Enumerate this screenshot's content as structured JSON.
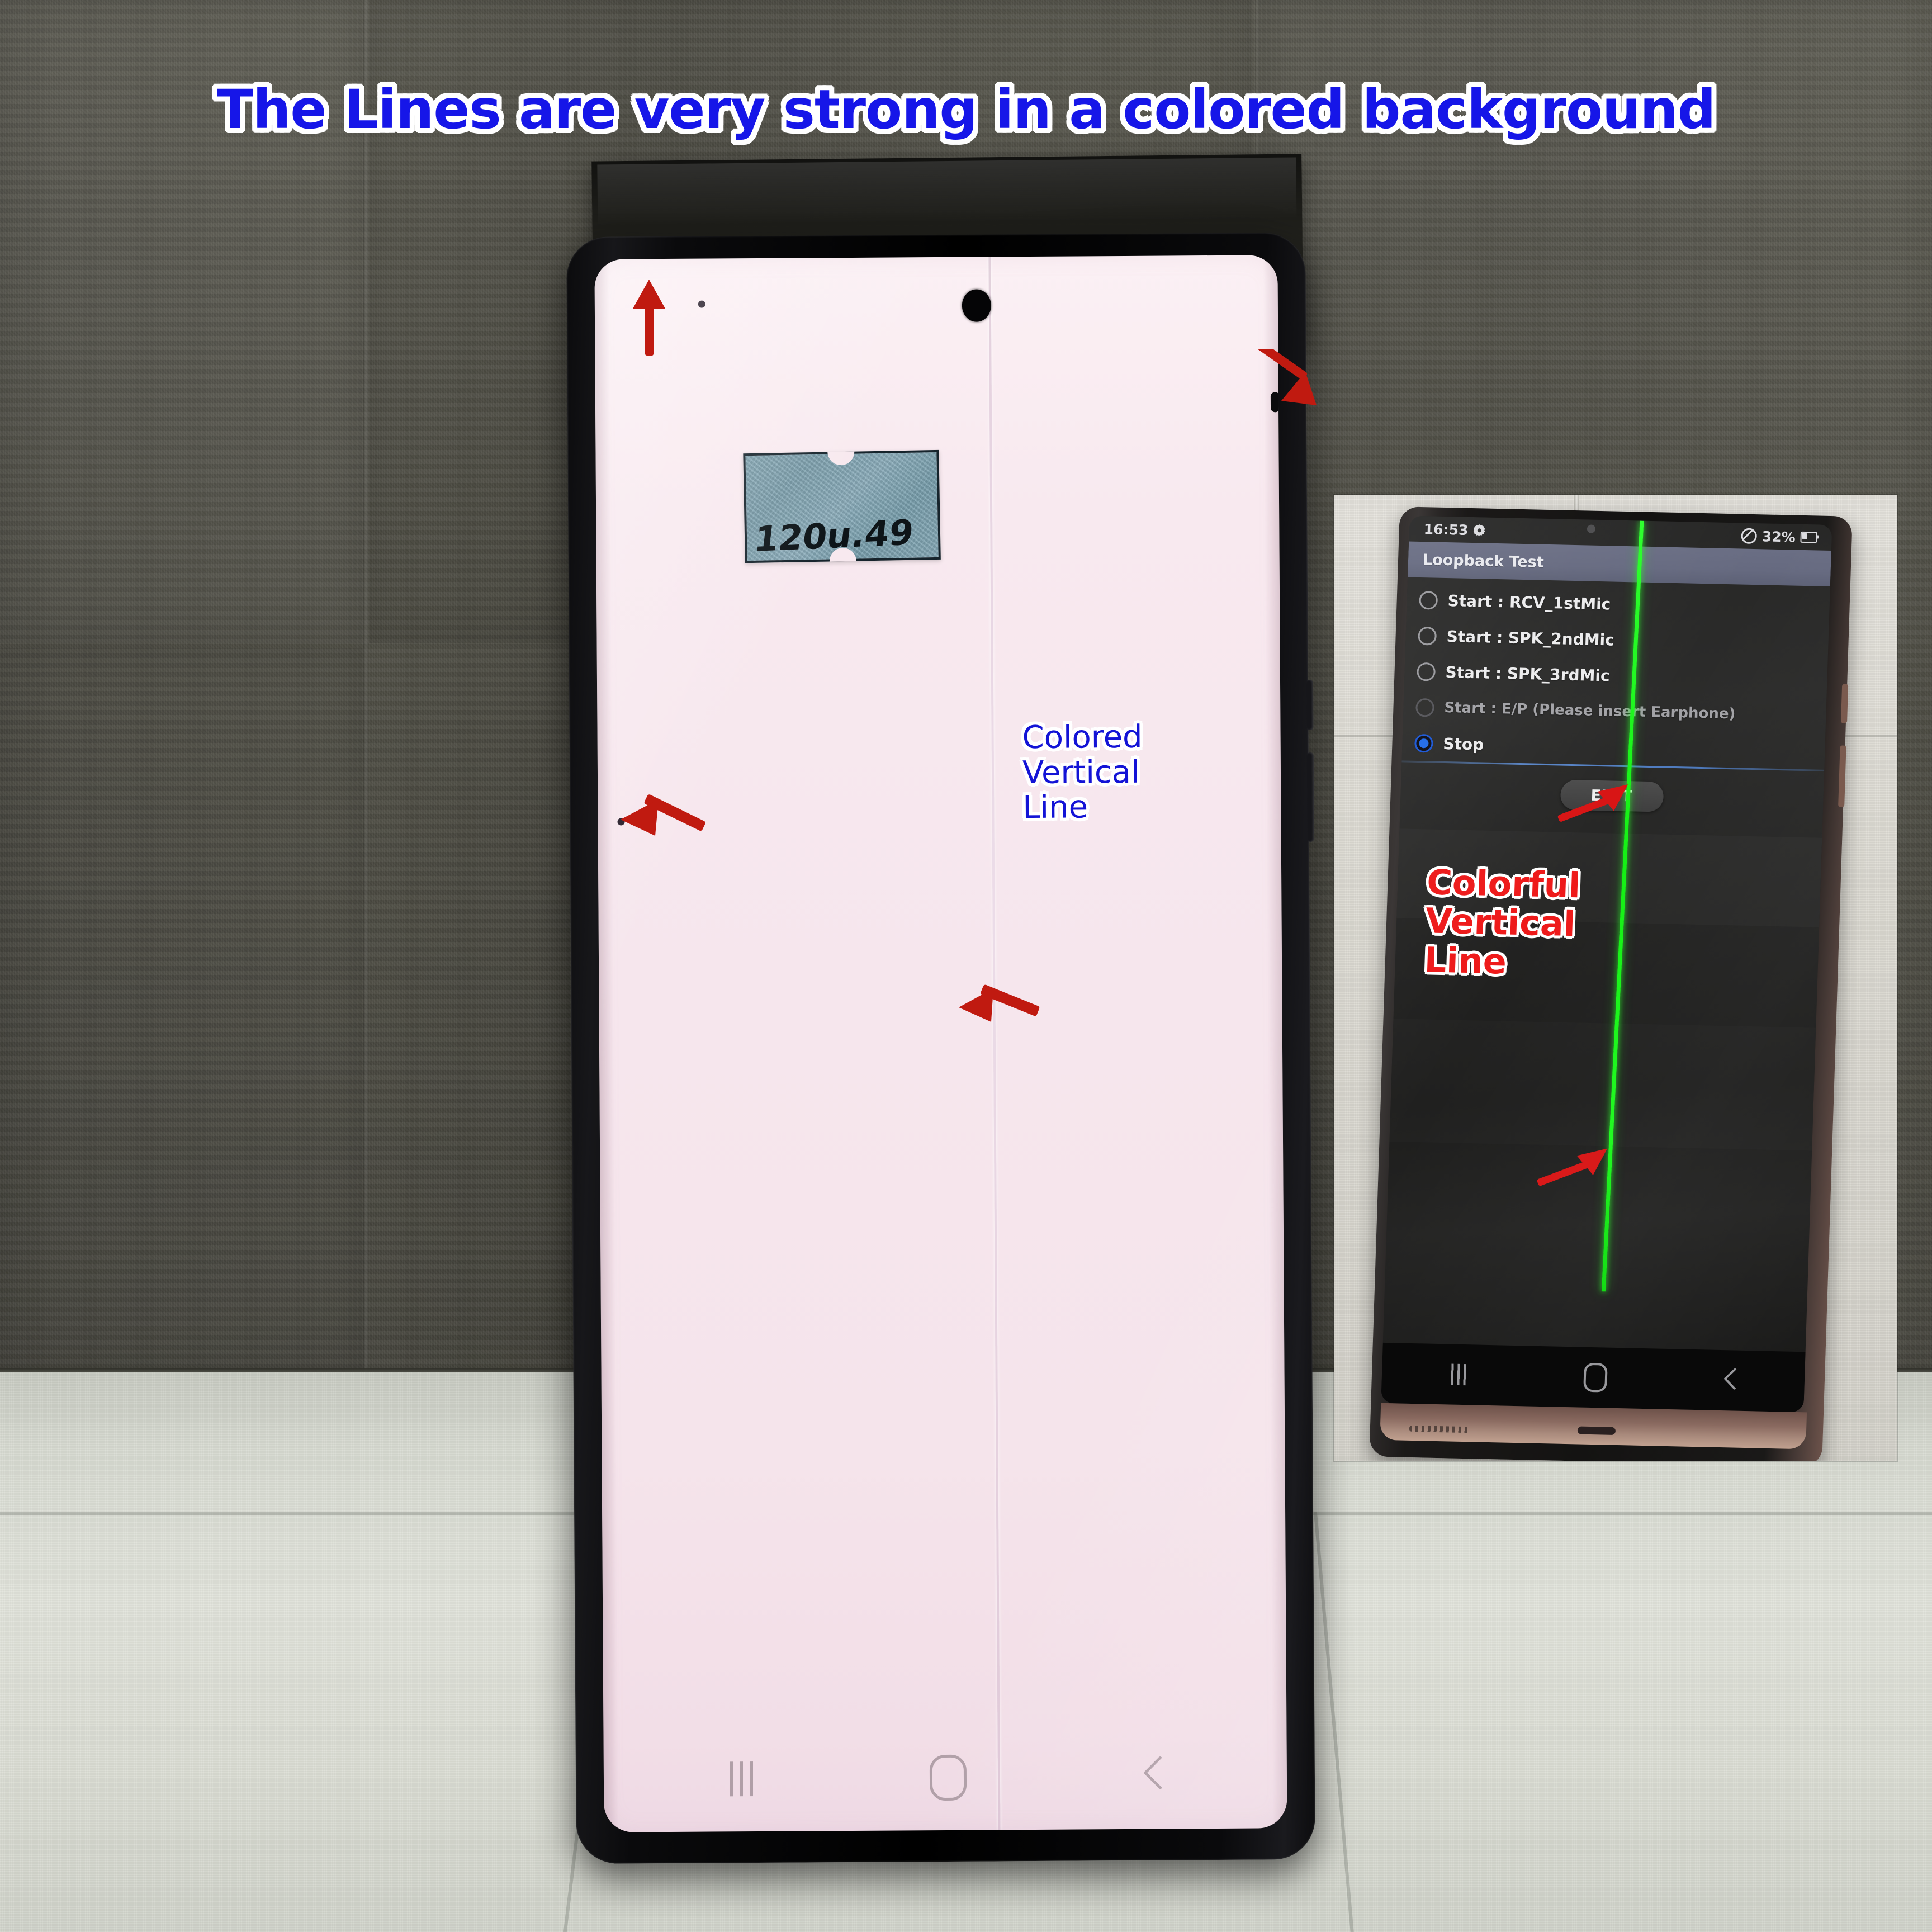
{
  "title": {
    "text": "The Lines are very strong in a colored background",
    "color": "#1313d6",
    "outline": "#ffffff"
  },
  "main_phone": {
    "screen_color": "#f8e9ef",
    "sticker": {
      "text": "120u.49",
      "color": "#83a7b5"
    },
    "annotation": {
      "line1": "Colored",
      "line2": "Vertical",
      "line3": "Line",
      "color": "#1313d6"
    },
    "defect_line_color": "#e8dbe6",
    "nav": {
      "recents": "recents-icon",
      "home": "home-icon",
      "back": "back-icon"
    },
    "markers": [
      {
        "name": "dead-pixel-top-left"
      },
      {
        "name": "dead-pixel-left-middle"
      },
      {
        "name": "edge-blemish-top-right"
      }
    ]
  },
  "inset_phone": {
    "status_bar": {
      "time": "16:53",
      "gear": "gear-icon",
      "dnd": "do-not-disturb-icon",
      "battery_percent": "32%",
      "battery": "battery-icon"
    },
    "app_bar": {
      "title": "Loopback Test",
      "color": "#666a80"
    },
    "options": [
      {
        "label": "Start : RCV_1stMic",
        "state": "unchecked",
        "dim": false
      },
      {
        "label": "Start : SPK_2ndMic",
        "state": "unchecked",
        "dim": false
      },
      {
        "label": "Start : SPK_3rdMic",
        "state": "unchecked",
        "dim": false
      },
      {
        "label": "Start : E/P (Please insert Earphone)",
        "state": "disabled",
        "dim": true
      },
      {
        "label": "Stop",
        "state": "checked",
        "dim": false
      }
    ],
    "exit_button": "EXIT",
    "annotation": {
      "line1": "Colorful",
      "line2": "Vertical",
      "line3": "Line",
      "color": "#ee1a1a"
    },
    "defect_line_color": "#18f018",
    "nav": {
      "recents": "recents-icon",
      "home": "home-icon",
      "back": "back-icon"
    }
  },
  "arrows": {
    "color": "#c01a10",
    "items": [
      {
        "name": "arrow-to-dead-pixel-top"
      },
      {
        "name": "arrow-to-edge-blemish"
      },
      {
        "name": "arrow-to-dead-pixel-left"
      },
      {
        "name": "arrow-to-colored-line"
      },
      {
        "name": "arrow-to-green-line-upper"
      },
      {
        "name": "arrow-to-green-line-lower"
      }
    ]
  }
}
